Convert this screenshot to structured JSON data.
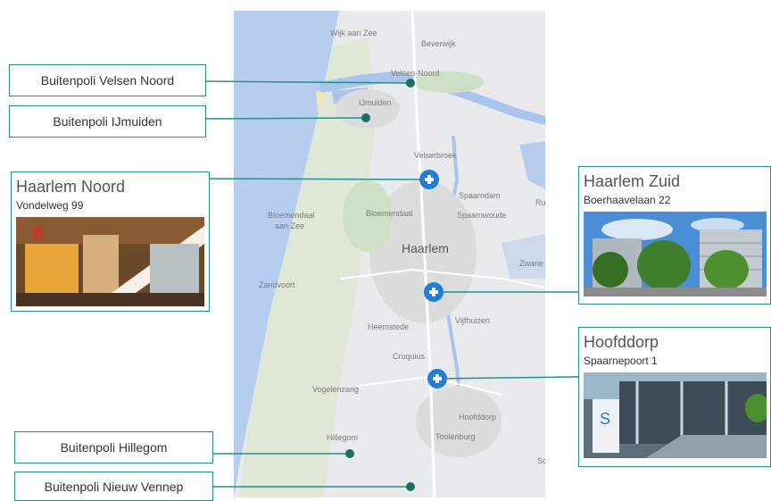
{
  "map_labels": {
    "wijk_aan_zee": "Wijk aan Zee",
    "beverwijk": "Beverwijk",
    "velsen_noord": "Velsen-Noord",
    "ijmuiden": "IJmuiden",
    "velserbroek": "Velserbroek",
    "spaarndam": "Spaarndam",
    "ru": "Ru",
    "bloemendaal_aan_zee_1": "Bloemendaal",
    "bloemendaal_aan_zee_2": "aan Zee",
    "bloemendaal": "Bloemendaal",
    "spaarnwoude": "Spaarnwoude",
    "haarlem": "Haarlem",
    "zwanenburg": "Zwane",
    "zandvoort": "Zandvoort",
    "heemstede": "Heemstede",
    "vijfhuizen": "Vijfhuizen",
    "cruquius": "Cruquius",
    "vogelenzang": "Vogelenzang",
    "hoofddorp": "Hoofddorp",
    "toolenburg": "Toolenburg",
    "hillegom": "Hillegom",
    "sc": "Sc"
  },
  "locations": {
    "velsen_noord": {
      "label": "Buitenpoli Velsen Noord"
    },
    "ijmuiden": {
      "label": "Buitenpoli IJmuiden"
    },
    "haarlem_noord": {
      "title": "Haarlem Noord",
      "address": "Vondelweg 99"
    },
    "haarlem_zuid": {
      "title": "Haarlem Zuid",
      "address": "Boerhaavelaan 22"
    },
    "hoofddorp": {
      "title": "Hoofddorp",
      "address": "Spaarnepoort 1"
    },
    "hillegom": {
      "label": "Buitenpoli Hillegom"
    },
    "nieuw_vennep": {
      "label": "Buitenpoli Nieuw Vennep"
    }
  },
  "colors": {
    "accent": "#2a8d8a",
    "marker_blue": "#1f7fd6",
    "marker_dot": "#1a6f66"
  }
}
